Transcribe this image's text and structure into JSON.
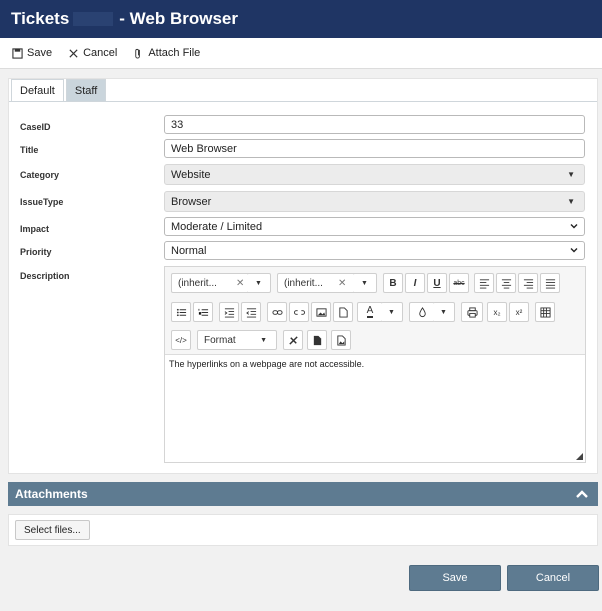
{
  "window": {
    "title_left": "Tickets",
    "title_right": "- Web Browser"
  },
  "toolbar": {
    "save_label": "Save",
    "cancel_label": "Cancel",
    "attach_label": "Attach File"
  },
  "tabs": [
    {
      "label": "Default"
    },
    {
      "label": "Staff"
    }
  ],
  "form": {
    "caseid": {
      "label": "CaseID",
      "value": "33"
    },
    "title": {
      "label": "Title",
      "value": "Web Browser"
    },
    "category": {
      "label": "Category",
      "value": "Website"
    },
    "issuetype": {
      "label": "IssueType",
      "value": "Browser"
    },
    "impact": {
      "label": "Impact",
      "value": "Moderate / Limited"
    },
    "priority": {
      "label": "Priority",
      "value": "Normal"
    },
    "description": {
      "label": "Description",
      "value": "The hyperlinks on a webpage are not accessible."
    }
  },
  "editor": {
    "font_family_value": "(inherit...",
    "font_size_value": "(inherit...",
    "format_label": "Format",
    "bold": "B",
    "italic": "I",
    "underline": "U",
    "strike": "abc",
    "font_color_letter": "A",
    "sub": "x₂",
    "sup": "x²"
  },
  "attachments": {
    "title": "Attachments",
    "select_files_label": "Select files..."
  },
  "footer": {
    "save_label": "Save",
    "cancel_label": "Cancel"
  },
  "colors": {
    "titlebar": "#1f3564",
    "accent": "#5e7b91"
  }
}
